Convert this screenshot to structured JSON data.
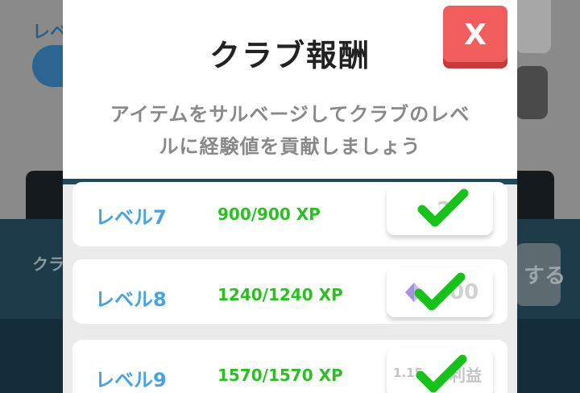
{
  "background": {
    "label_fragment": "レベ",
    "lower_label_fragment": "クラ",
    "lower_button_fragment": "する"
  },
  "modal": {
    "title": "クラブ報酬",
    "description_line1": "アイテムをサルベージしてクラブのレベ",
    "description_line2": "ルに経験値を貢献しましょう",
    "close_label": "X"
  },
  "rewards": [
    {
      "level": "レベル7",
      "xp": "900/900 XP",
      "reward_text": "2",
      "claimed": true
    },
    {
      "level": "レベル8",
      "xp": "1240/1240 XP",
      "reward_text": "00",
      "claimed": true
    },
    {
      "level": "レベル9",
      "xp": "1570/1570 XP",
      "reward_text": "1.15",
      "reward_text_2": "利益",
      "claimed": true
    }
  ],
  "colors": {
    "level_text": "#4aa3df",
    "xp_text": "#2bbf24",
    "check": "#17c21a",
    "close_button": "#f25e5e",
    "divider": "#1f4a5c"
  }
}
